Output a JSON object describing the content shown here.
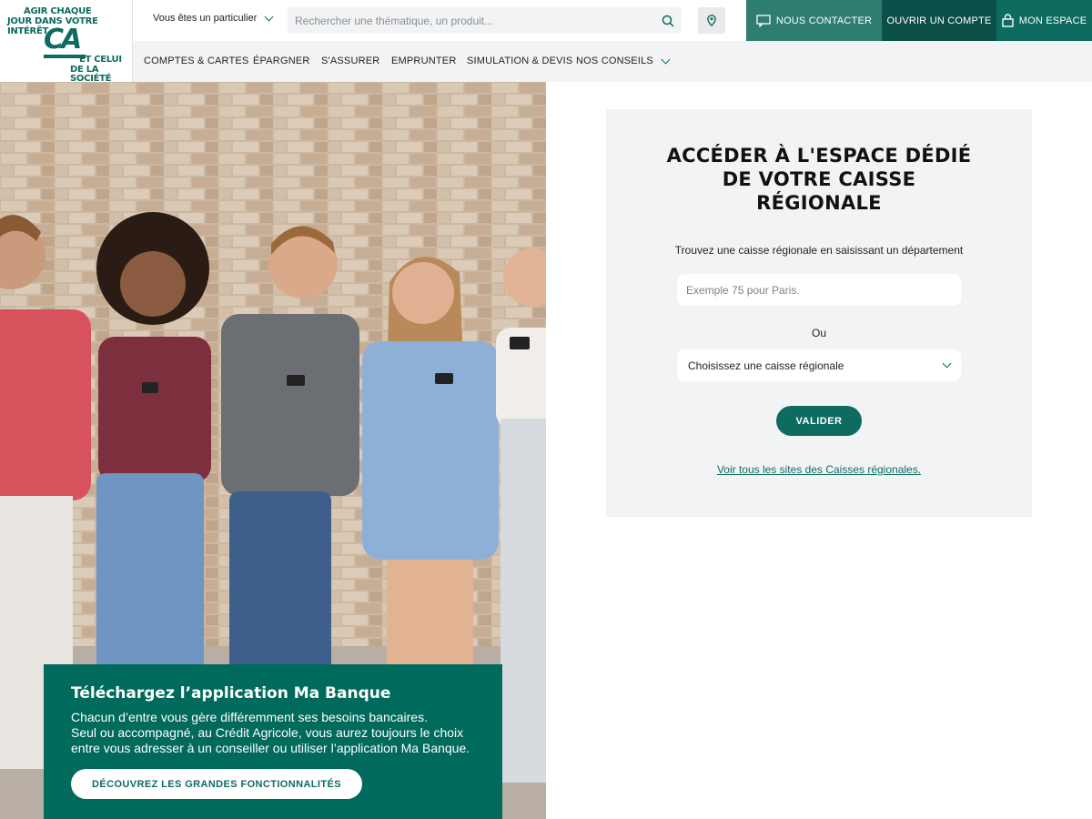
{
  "logo": {
    "line1": "AGIR CHAQUE",
    "line2": "JOUR DANS VOTRE",
    "line3": "INTÉRÊT",
    "mark": "CA",
    "line4": "ET CELUI",
    "line5": "DE LA SOCIÉTÉ"
  },
  "topbar": {
    "profile_label": "Vous êtes un particulier",
    "search_placeholder": "Rechercher une thématique, un produit...",
    "contact_label": "NOUS CONTACTER",
    "open_account_label": "OUVRIR UN COMPTE",
    "my_space_label": "MON ESPACE"
  },
  "nav": {
    "items": [
      {
        "label": "COMPTES & CARTES"
      },
      {
        "label": "ÉPARGNER"
      },
      {
        "label": "S'ASSURER"
      },
      {
        "label": "EMPRUNTER"
      },
      {
        "label": "SIMULATION & DEVIS"
      },
      {
        "label": "NOS CONSEILS"
      }
    ]
  },
  "promo": {
    "title": "Téléchargez l’application Ma Banque",
    "line1": "Chacun d’entre vous gère différemment ses besoins bancaires.",
    "line2": "Seul ou accompagné, au Crédit Agricole, vous aurez toujours le choix",
    "line3": "entre vous adresser à un conseiller ou utiliser l’application Ma Banque.",
    "button_label": "DÉCOUVREZ LES GRANDES FONCTIONNALITÉS"
  },
  "locator": {
    "title_line1": "ACCÉDER À L'ESPACE DÉDIÉ",
    "title_line2": "DE VOTRE CAISSE",
    "title_line3": "RÉGIONALE",
    "subtitle": "Trouvez une caisse régionale en saisissant un département",
    "input_placeholder": "Exemple 75 pour Paris.",
    "or_label": "Ou",
    "select_value": "Choisissez une caisse régionale",
    "submit_label": "VALIDER",
    "all_sites_link": "Voir tous les sites des Caisses régionales."
  },
  "colors": {
    "brand_green": "#0d6b5f",
    "dark_green": "#0c4f48",
    "mid_green": "#2f7d71",
    "panel_bg": "#f2f3f4"
  }
}
